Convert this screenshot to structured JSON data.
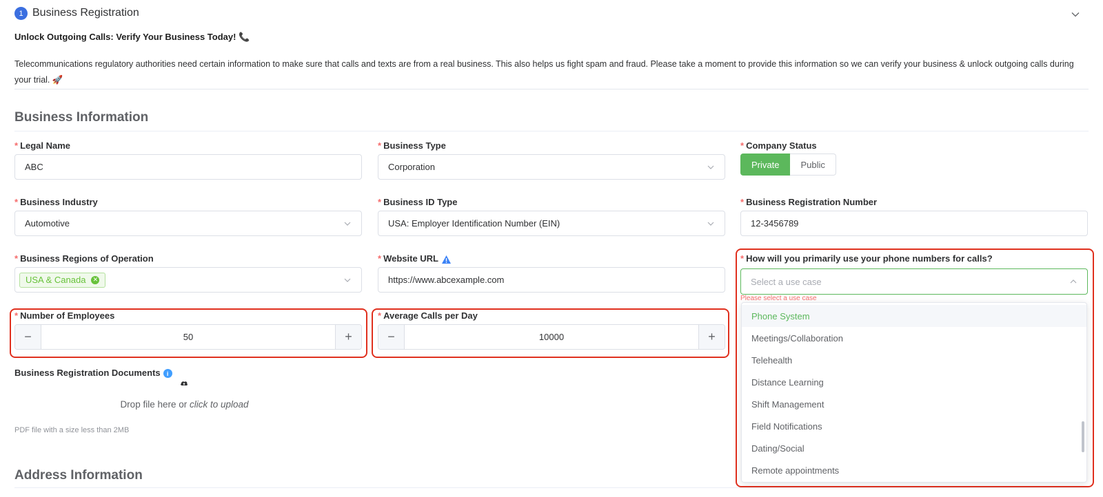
{
  "header": {
    "step_number": "1",
    "title": "Business Registration",
    "headline": "Unlock Outgoing Calls: Verify Your Business Today! 📞",
    "intro": "Telecommunications regulatory authorities need certain information to make sure that calls and texts are from a real business. This also helps us fight spam and fraud. Please take a moment to provide this information so we can verify your business & unlock outgoing calls during your trial. 🚀"
  },
  "sections": {
    "business_info": "Business Information",
    "address_info": "Address Information"
  },
  "required_mark": "*",
  "fields": {
    "legal_name": {
      "label": "Legal Name",
      "value": "ABC"
    },
    "business_type": {
      "label": "Business Type",
      "value": "Corporation"
    },
    "company_status": {
      "label": "Company Status",
      "options": [
        "Private",
        "Public"
      ],
      "selected": "Private"
    },
    "business_industry": {
      "label": "Business Industry",
      "value": "Automotive"
    },
    "business_id_type": {
      "label": "Business ID Type",
      "value": "USA: Employer Identification Number (EIN)"
    },
    "business_registration_number": {
      "label": "Business Registration Number",
      "value": "12-3456789"
    },
    "regions": {
      "label": "Business Regions of Operation",
      "tags": [
        "USA & Canada"
      ]
    },
    "website_url": {
      "label": "Website URL",
      "value": "https://www.abcexample.com"
    },
    "use_case": {
      "label": "How will you primarily use your phone numbers for calls?",
      "placeholder": "Select a use case",
      "error": "Please select a use case",
      "options": [
        "Phone System",
        "Meetings/Collaboration",
        "Telehealth",
        "Distance Learning",
        "Shift Management",
        "Field Notifications",
        "Dating/Social",
        "Remote appointments"
      ],
      "highlighted": "Phone System"
    },
    "employees": {
      "label": "Number of Employees",
      "value": "50",
      "minus": "−",
      "plus": "+"
    },
    "avg_calls": {
      "label": "Average Calls per Day",
      "value": "10000",
      "minus": "−",
      "plus": "+"
    },
    "documents": {
      "label": "Business Registration Documents",
      "info": "i",
      "drop_text": "Drop file here or ",
      "click_text": "click to upload",
      "tip": "PDF file with a size less than 2MB"
    }
  },
  "colors": {
    "accent_green": "#5cb85c",
    "step_blue": "#3b6fe0",
    "required_red": "#f56c6c",
    "highlight_red": "#e0301e"
  }
}
